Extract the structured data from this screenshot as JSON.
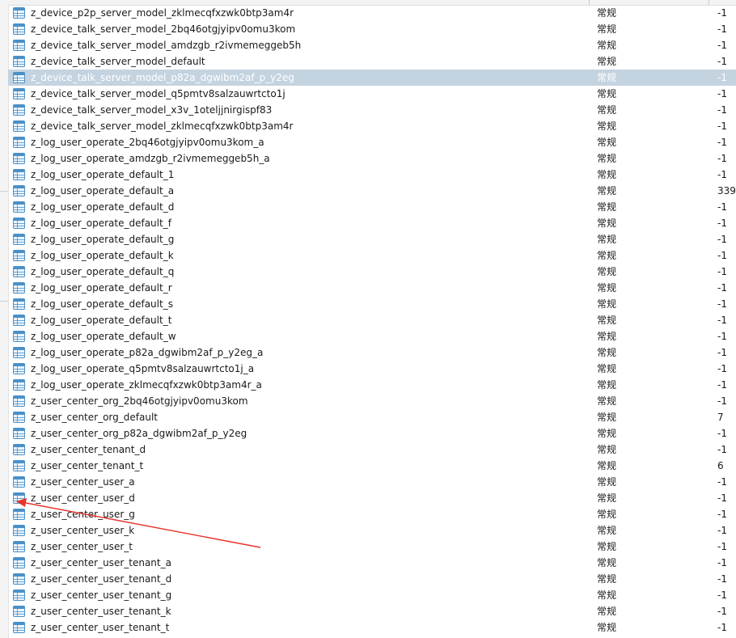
{
  "tables": [
    {
      "name": "z_device_p2p_server_model_zklmecqfxzwk0btp3am4r",
      "type": "常规",
      "rows": "-1"
    },
    {
      "name": "z_device_talk_server_model_2bq46otgjyipv0omu3kom",
      "type": "常规",
      "rows": "-1"
    },
    {
      "name": "z_device_talk_server_model_amdzgb_r2ivmemeggeb5h",
      "type": "常规",
      "rows": "-1"
    },
    {
      "name": "z_device_talk_server_model_default",
      "type": "常规",
      "rows": "-1"
    },
    {
      "name": "z_device_talk_server_model_p82a_dgwibm2af_p_y2eg",
      "type": "常规",
      "rows": "-1",
      "selected": true
    },
    {
      "name": "z_device_talk_server_model_q5pmtv8salzauwrtcto1j",
      "type": "常规",
      "rows": "-1"
    },
    {
      "name": "z_device_talk_server_model_x3v_1oteljjnirgispf83",
      "type": "常规",
      "rows": "-1"
    },
    {
      "name": "z_device_talk_server_model_zklmecqfxzwk0btp3am4r",
      "type": "常规",
      "rows": "-1"
    },
    {
      "name": "z_log_user_operate_2bq46otgjyipv0omu3kom_a",
      "type": "常规",
      "rows": "-1"
    },
    {
      "name": "z_log_user_operate_amdzgb_r2ivmemeggeb5h_a",
      "type": "常规",
      "rows": "-1"
    },
    {
      "name": "z_log_user_operate_default_1",
      "type": "常规",
      "rows": "-1"
    },
    {
      "name": "z_log_user_operate_default_a",
      "type": "常规",
      "rows": "339"
    },
    {
      "name": "z_log_user_operate_default_d",
      "type": "常规",
      "rows": "-1"
    },
    {
      "name": "z_log_user_operate_default_f",
      "type": "常规",
      "rows": "-1"
    },
    {
      "name": "z_log_user_operate_default_g",
      "type": "常规",
      "rows": "-1"
    },
    {
      "name": "z_log_user_operate_default_k",
      "type": "常规",
      "rows": "-1"
    },
    {
      "name": "z_log_user_operate_default_q",
      "type": "常规",
      "rows": "-1"
    },
    {
      "name": "z_log_user_operate_default_r",
      "type": "常规",
      "rows": "-1"
    },
    {
      "name": "z_log_user_operate_default_s",
      "type": "常规",
      "rows": "-1"
    },
    {
      "name": "z_log_user_operate_default_t",
      "type": "常规",
      "rows": "-1"
    },
    {
      "name": "z_log_user_operate_default_w",
      "type": "常规",
      "rows": "-1"
    },
    {
      "name": "z_log_user_operate_p82a_dgwibm2af_p_y2eg_a",
      "type": "常规",
      "rows": "-1"
    },
    {
      "name": "z_log_user_operate_q5pmtv8salzauwrtcto1j_a",
      "type": "常规",
      "rows": "-1"
    },
    {
      "name": "z_log_user_operate_zklmecqfxzwk0btp3am4r_a",
      "type": "常规",
      "rows": "-1"
    },
    {
      "name": "z_user_center_org_2bq46otgjyipv0omu3kom",
      "type": "常规",
      "rows": "-1"
    },
    {
      "name": "z_user_center_org_default",
      "type": "常规",
      "rows": "7"
    },
    {
      "name": "z_user_center_org_p82a_dgwibm2af_p_y2eg",
      "type": "常规",
      "rows": "-1"
    },
    {
      "name": "z_user_center_tenant_d",
      "type": "常规",
      "rows": "-1"
    },
    {
      "name": "z_user_center_tenant_t",
      "type": "常规",
      "rows": "6"
    },
    {
      "name": "z_user_center_user_a",
      "type": "常规",
      "rows": "-1"
    },
    {
      "name": "z_user_center_user_d",
      "type": "常规",
      "rows": "-1"
    },
    {
      "name": "z_user_center_user_g",
      "type": "常规",
      "rows": "-1"
    },
    {
      "name": "z_user_center_user_k",
      "type": "常规",
      "rows": "-1"
    },
    {
      "name": "z_user_center_user_t",
      "type": "常规",
      "rows": "-1"
    },
    {
      "name": "z_user_center_user_tenant_a",
      "type": "常规",
      "rows": "-1"
    },
    {
      "name": "z_user_center_user_tenant_d",
      "type": "常规",
      "rows": "-1"
    },
    {
      "name": "z_user_center_user_tenant_g",
      "type": "常规",
      "rows": "-1"
    },
    {
      "name": "z_user_center_user_tenant_k",
      "type": "常规",
      "rows": "-1"
    },
    {
      "name": "z_user_center_user_tenant_t",
      "type": "常规",
      "rows": "-1"
    }
  ],
  "icon": "table-grid-icon",
  "colors": {
    "selection": "#c4d3e0",
    "icon_blue": "#4a90c8",
    "annotation_arrow": "#e8322a"
  },
  "annotation": {
    "type": "arrow",
    "points_to_row": 30
  }
}
